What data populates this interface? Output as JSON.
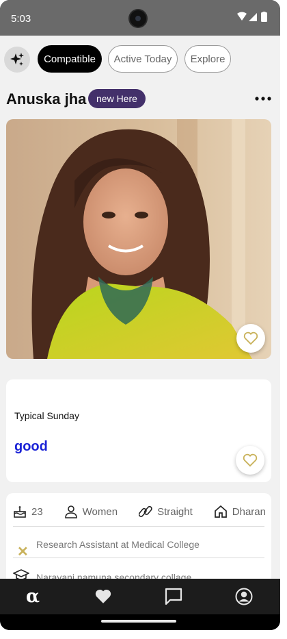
{
  "status_bar": {
    "time": "5:03"
  },
  "filters": {
    "sparkle_icon": "sparkle-icon",
    "chips": [
      {
        "label": "Compatible",
        "active": true
      },
      {
        "label": "Active Today",
        "active": false
      },
      {
        "label": "Explore",
        "active": false
      }
    ]
  },
  "profile": {
    "name": "Anuska jha",
    "badge": "new Here",
    "prompt": {
      "label": "Typical Sunday",
      "answer": "good"
    },
    "facts": [
      {
        "icon": "cake-icon",
        "value": "23"
      },
      {
        "icon": "person-icon",
        "value": "Women"
      },
      {
        "icon": "orientation-icon",
        "value": "Straight"
      },
      {
        "icon": "home-icon",
        "value": "Dharan"
      }
    ],
    "job": "Research Assistant at Medical College",
    "education": "Narayani namuna secondary collage"
  },
  "nav": {
    "items": [
      {
        "icon": "alpha-icon",
        "glyph": "α"
      },
      {
        "icon": "heart-icon"
      },
      {
        "icon": "chat-icon"
      },
      {
        "icon": "profile-icon"
      }
    ]
  },
  "colors": {
    "accent_dark": "#000000",
    "badge_bg": "#43306a",
    "answer_text": "#1a22d6",
    "heart_outline": "#c9b25b",
    "screen_bg": "#f1f1f1"
  }
}
